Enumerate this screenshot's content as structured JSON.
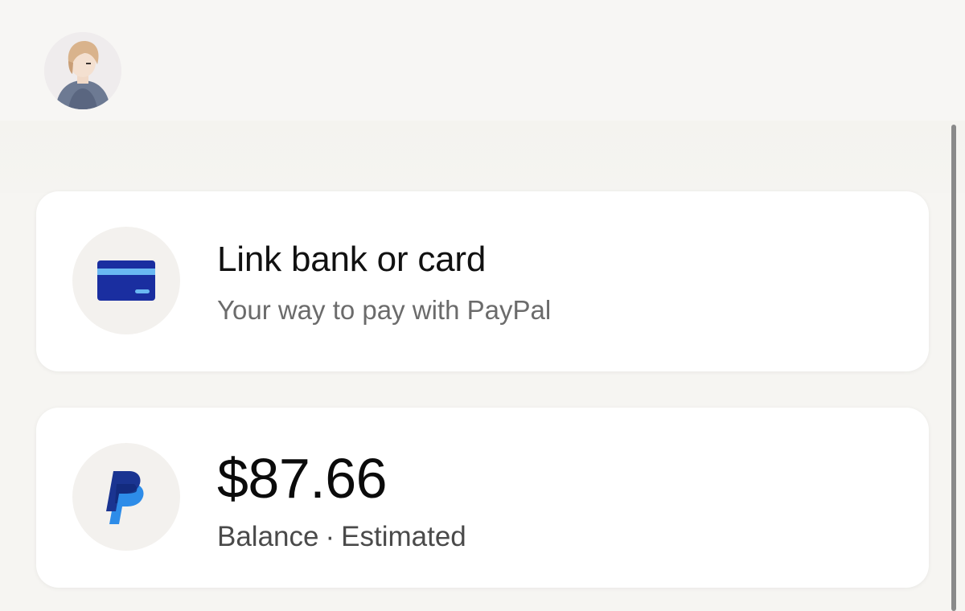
{
  "link_card": {
    "title": "Link bank or card",
    "subtitle": "Your way to pay with PayPal",
    "icon": "credit-card-icon",
    "icon_color": "#1a2ea0",
    "icon_stripe_color": "#6ab8f2"
  },
  "balance_card": {
    "amount": "$87.66",
    "label": "Balance",
    "separator": "·",
    "status": "Estimated",
    "icon": "paypal-logo-icon",
    "logo_colors": [
      "#1a3491",
      "#2d8ce8"
    ]
  },
  "colors": {
    "background": "#f6f5f2",
    "card_background": "#ffffff",
    "icon_circle": "#f3f1ee"
  }
}
